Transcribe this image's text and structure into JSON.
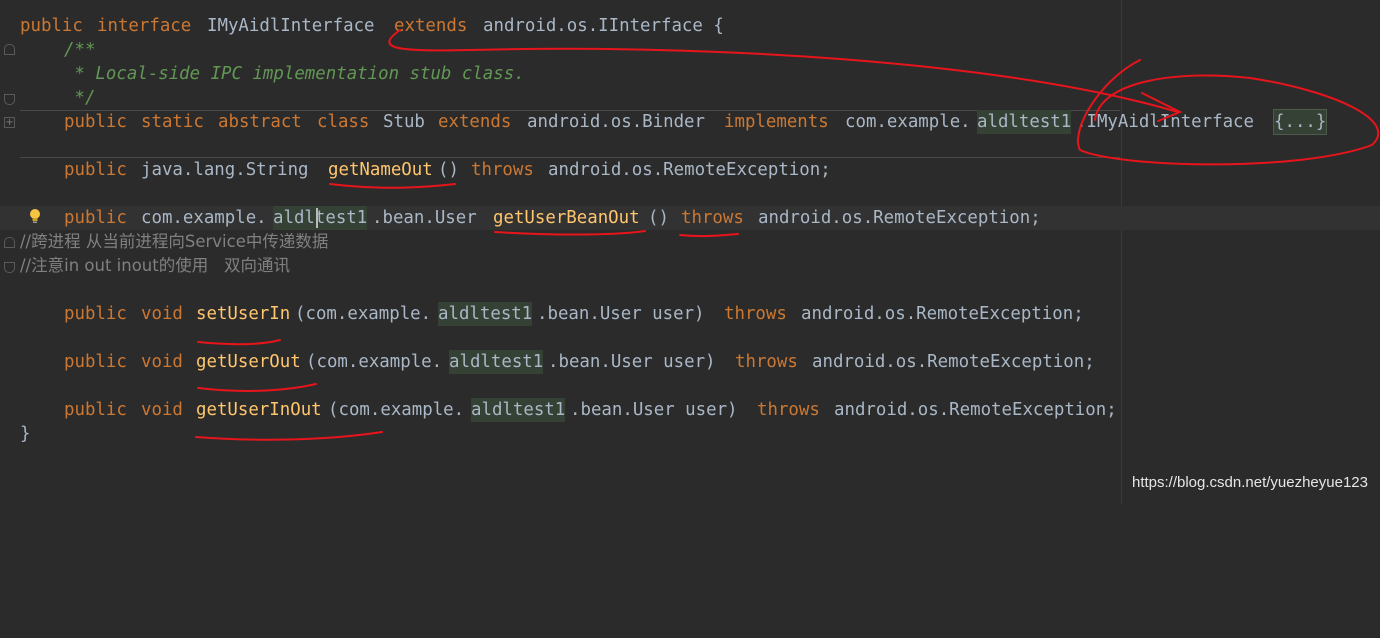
{
  "code": {
    "l1": {
      "a": "public",
      "b": "interface",
      "c": "IMyAidlInterface",
      "d": "extends",
      "e": "android.os.IInterface {"
    },
    "l2": "/**",
    "l3": " * Local-side IPC implementation stub class.",
    "l4": " */",
    "l5": {
      "a": "public",
      "b": "static",
      "c": "abstract",
      "d": "class",
      "e": "Stub",
      "f": "extends",
      "g": "android.os.Binder",
      "h": "implements",
      "i": "com.example.",
      "j": "aldltest1",
      "k": ".IMyAidlInterface",
      "fold": "{...}"
    },
    "l6": {
      "a": "public",
      "b": "java.lang.String",
      "m": "getNameOut",
      "c": "()",
      "d": "throws",
      "e": "android.os.RemoteException;"
    },
    "l7": {
      "a": "public",
      "b": "com.example.",
      "j": "aldltest1",
      "c": ".bean.User",
      "m": "getUserBeanOut",
      "d": "()",
      "e": "throws",
      "f": "android.os.RemoteException;"
    },
    "l8": "//跨进程 从当前进程向Service中传递数据",
    "l9": "//注意in out inout的使用   双向通讯",
    "l10": {
      "a": "public",
      "b": "void",
      "m": "setUserIn",
      "c": "(com.example.",
      "j": "aldltest1",
      "d": ".bean.User user)",
      "e": "throws",
      "f": "android.os.RemoteException;"
    },
    "l11": {
      "a": "public",
      "b": "void",
      "m": "getUserOut",
      "c": "(com.example.",
      "j": "aldltest1",
      "d": ".bean.User user)",
      "e": "throws",
      "f": "android.os.RemoteException;"
    },
    "l12": {
      "a": "public",
      "b": "void",
      "m": "getUserInOut",
      "c": "(com.example.",
      "j": "aldltest1",
      "d": ".bean.User user)",
      "e": "throws",
      "f": "android.os.RemoteException;"
    },
    "l13": "}"
  },
  "icons": {
    "fold": "fold-marker-icon",
    "bulb": "lightbulb-icon"
  },
  "watermark": "https://blog.csdn.net/yuezheyue123",
  "colors": {
    "background": "#2b2b2b",
    "keyword": "#cc7832",
    "method": "#ffc66d",
    "doc_comment": "#629755",
    "line_comment": "#808080",
    "default_text": "#a9b7c6",
    "annotation_ink": "#e8141c"
  }
}
